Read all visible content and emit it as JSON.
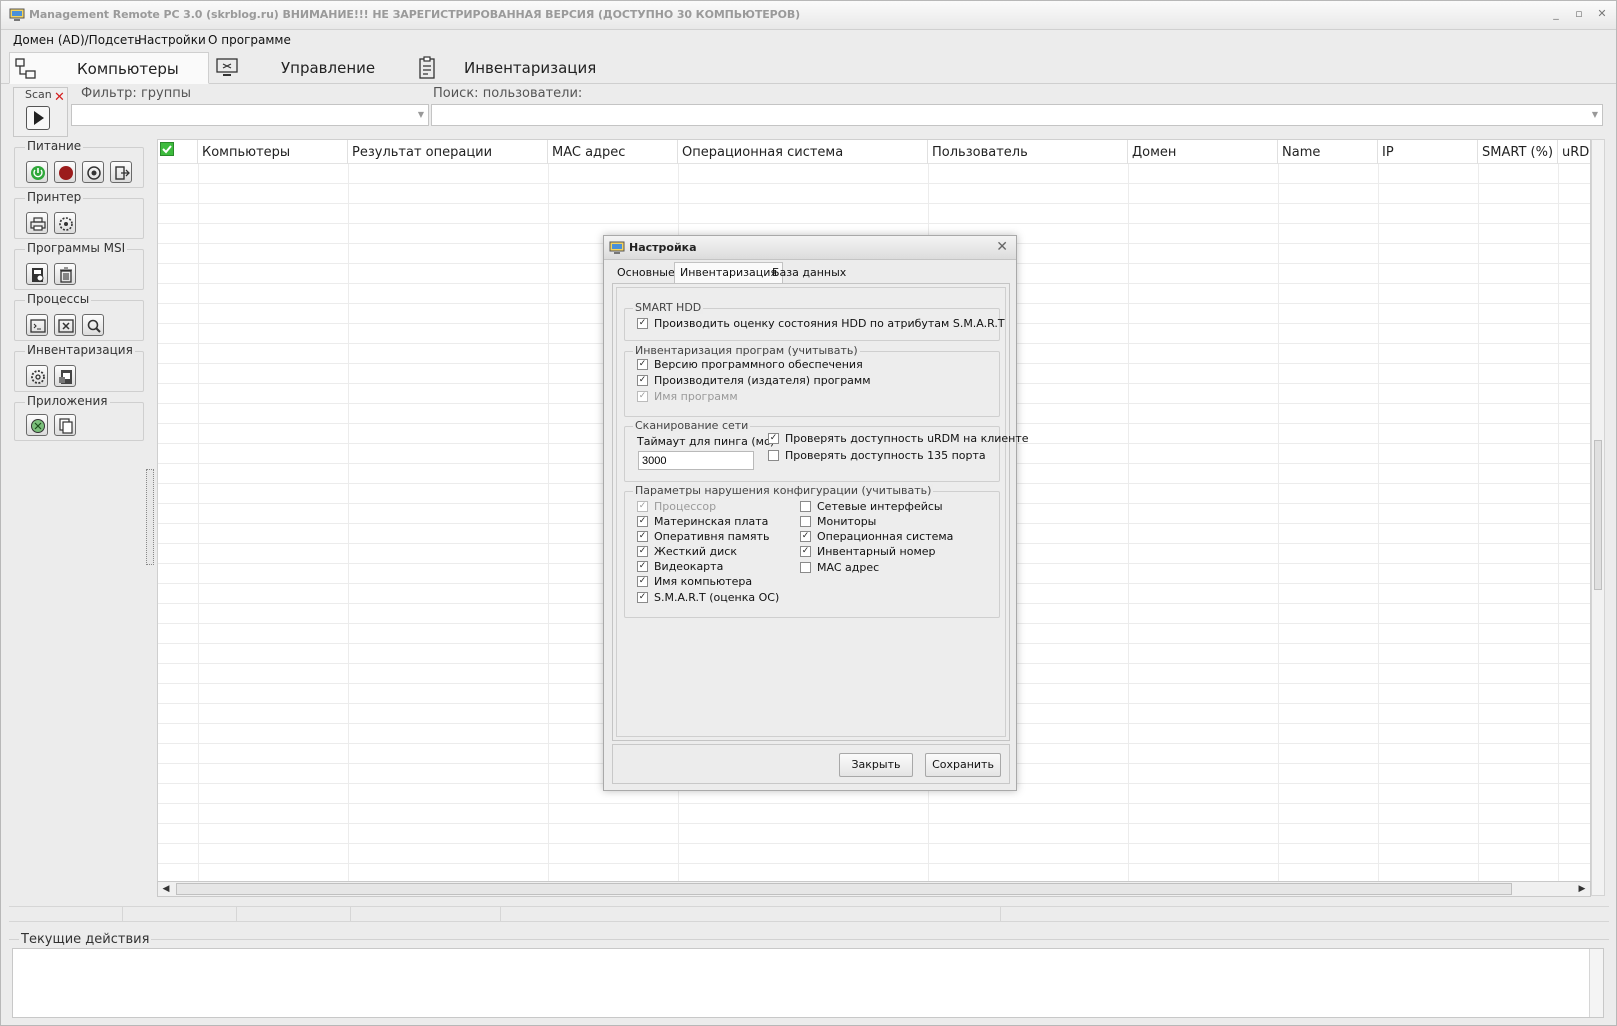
{
  "window": {
    "title": "Management Remote PC 3.0 (skrblog.ru) ВНИМАНИЕ!!! НЕ ЗАРЕГИСТРИРОВАННАЯ ВЕРСИЯ (ДОСТУПНО 30 КОМПЬЮТЕРОВ)",
    "minimize": "_",
    "maximize": "▫",
    "close": "✕"
  },
  "menu": [
    "Домен (AD)/Подсеть",
    "Настройки",
    "О программе"
  ],
  "main_tabs": [
    {
      "label": "Компьютеры",
      "icon": "network-computers-icon",
      "active": true
    },
    {
      "label": "Управление",
      "icon": "monitor-control-icon",
      "active": false
    },
    {
      "label": "Инвентаризация",
      "icon": "clipboard-icon",
      "active": false
    }
  ],
  "scan": {
    "label": "Scan",
    "stop": "✕"
  },
  "filter": {
    "groups_label": "Фильтр: группы",
    "search_label": "Поиск: пользователи:"
  },
  "sidebar": [
    {
      "title": "Питание",
      "buttons": [
        "power-on-icon",
        "power-off-icon",
        "restart-icon",
        "logoff-icon"
      ]
    },
    {
      "title": "Принтер",
      "buttons": [
        "printer-icon",
        "printer-settings-icon"
      ]
    },
    {
      "title": "Программы MSI",
      "buttons": [
        "install-msi-icon",
        "uninstall-icon"
      ]
    },
    {
      "title": "Процессы",
      "buttons": [
        "process-list-icon",
        "kill-process-icon",
        "search-process-icon"
      ]
    },
    {
      "title": "Инвентаризация",
      "buttons": [
        "inventory-settings-icon",
        "inventory-report-icon"
      ]
    },
    {
      "title": "Приложения",
      "buttons": [
        "remote-app-icon",
        "copy-files-icon"
      ]
    }
  ],
  "grid": {
    "columns": [
      "Компьютеры",
      "Результат операции",
      "MAC адрес",
      "Операционная система",
      "Пользователь",
      "Домен",
      "Name",
      "IP",
      "SMART (%)",
      "uRD"
    ]
  },
  "actions": {
    "label": "Текущие действия"
  },
  "dialog": {
    "title": "Настройка",
    "close": "✕",
    "tabs": [
      "Основные",
      "Инвентаризация",
      "База данных"
    ],
    "active_tab": 1,
    "smart": {
      "legend": "SMART HDD",
      "items": [
        {
          "label": "Производить оценку состояния HDD по атрибутам  S.M.A.R.T",
          "checked": true,
          "disabled": false
        }
      ]
    },
    "software": {
      "legend": "Инвентаризация програм (учитывать)",
      "items": [
        {
          "label": "Версию программного обеспечения",
          "checked": true,
          "disabled": false
        },
        {
          "label": "Производителя (издателя) программ",
          "checked": true,
          "disabled": false
        },
        {
          "label": "Имя программ",
          "checked": true,
          "disabled": true
        }
      ]
    },
    "network": {
      "legend": "Сканирование сети",
      "ping_label": "Таймаут для пинга (мс)",
      "ping_value": "3000",
      "items": [
        {
          "label": "Проверять доступность uRDM на клиенте",
          "checked": true,
          "disabled": false
        },
        {
          "label": "Проверять доступность 135 порта",
          "checked": false,
          "disabled": false
        }
      ]
    },
    "config": {
      "legend": "Параметры нарушения конфигурации (учитывать)",
      "left": [
        {
          "label": "Процессор",
          "checked": true,
          "disabled": true
        },
        {
          "label": "Материнская плата",
          "checked": true,
          "disabled": false
        },
        {
          "label": "Оперативня память",
          "checked": true,
          "disabled": false
        },
        {
          "label": "Жесткий диск",
          "checked": true,
          "disabled": false
        },
        {
          "label": "Видеокарта",
          "checked": true,
          "disabled": false
        },
        {
          "label": "Имя компьютера",
          "checked": true,
          "disabled": false
        },
        {
          "label": "S.M.A.R.T (оценка ОС)",
          "checked": true,
          "disabled": false
        }
      ],
      "right": [
        {
          "label": "Сетевые интерфейсы",
          "checked": false,
          "disabled": false
        },
        {
          "label": "Мониторы",
          "checked": false,
          "disabled": false
        },
        {
          "label": "Операционная система",
          "checked": true,
          "disabled": false
        },
        {
          "label": "Инвентарный номер",
          "checked": true,
          "disabled": false
        },
        {
          "label": "MAC адрес",
          "checked": false,
          "disabled": false
        }
      ]
    },
    "buttons": {
      "close": "Закрыть",
      "save": "Сохранить"
    }
  }
}
